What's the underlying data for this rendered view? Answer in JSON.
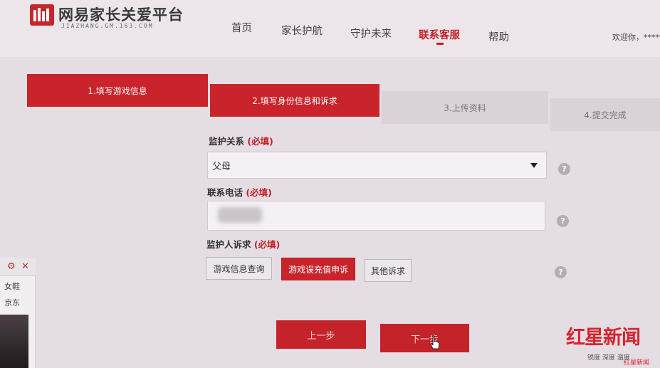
{
  "header": {
    "logo_title": "网易家长关爱平台",
    "logo_subtitle": "JIAZHANG.GM.163.COM",
    "nav": [
      {
        "label": "首页"
      },
      {
        "label": "家长护航"
      },
      {
        "label": "守护未来"
      },
      {
        "label": "联系客服",
        "active": true
      },
      {
        "label": "帮助"
      }
    ],
    "welcome": "欢迎你，*****"
  },
  "steps": [
    {
      "label": "1.填写游戏信息",
      "state": "done"
    },
    {
      "label": "2.填写身份信息和诉求",
      "state": "current"
    },
    {
      "label": "3.上传资料",
      "state": "todo"
    },
    {
      "label": "4.提交完成",
      "state": "todo"
    }
  ],
  "form": {
    "relation": {
      "label": "监护关系",
      "required": "(必填)",
      "value": "父母"
    },
    "phone": {
      "label": "联系电话",
      "required": "(必填)",
      "value": ""
    },
    "appeal": {
      "label": "监护人诉求",
      "required": "(必填)",
      "options": [
        {
          "label": "游戏信息查询",
          "selected": false
        },
        {
          "label": "游戏误充值申诉",
          "selected": true
        },
        {
          "label": "其他诉求",
          "selected": false
        }
      ]
    },
    "help_glyph": "?"
  },
  "buttons": {
    "prev": "上一步",
    "next": "下一步"
  },
  "side_panel": {
    "items": [
      "女鞋",
      "京东"
    ]
  },
  "watermark": {
    "title": "红星新闻",
    "slogan": "锐度 深度 温度",
    "mini": "红星新闻"
  },
  "colors": {
    "accent": "#c9232b",
    "background": "#e4dde3"
  }
}
